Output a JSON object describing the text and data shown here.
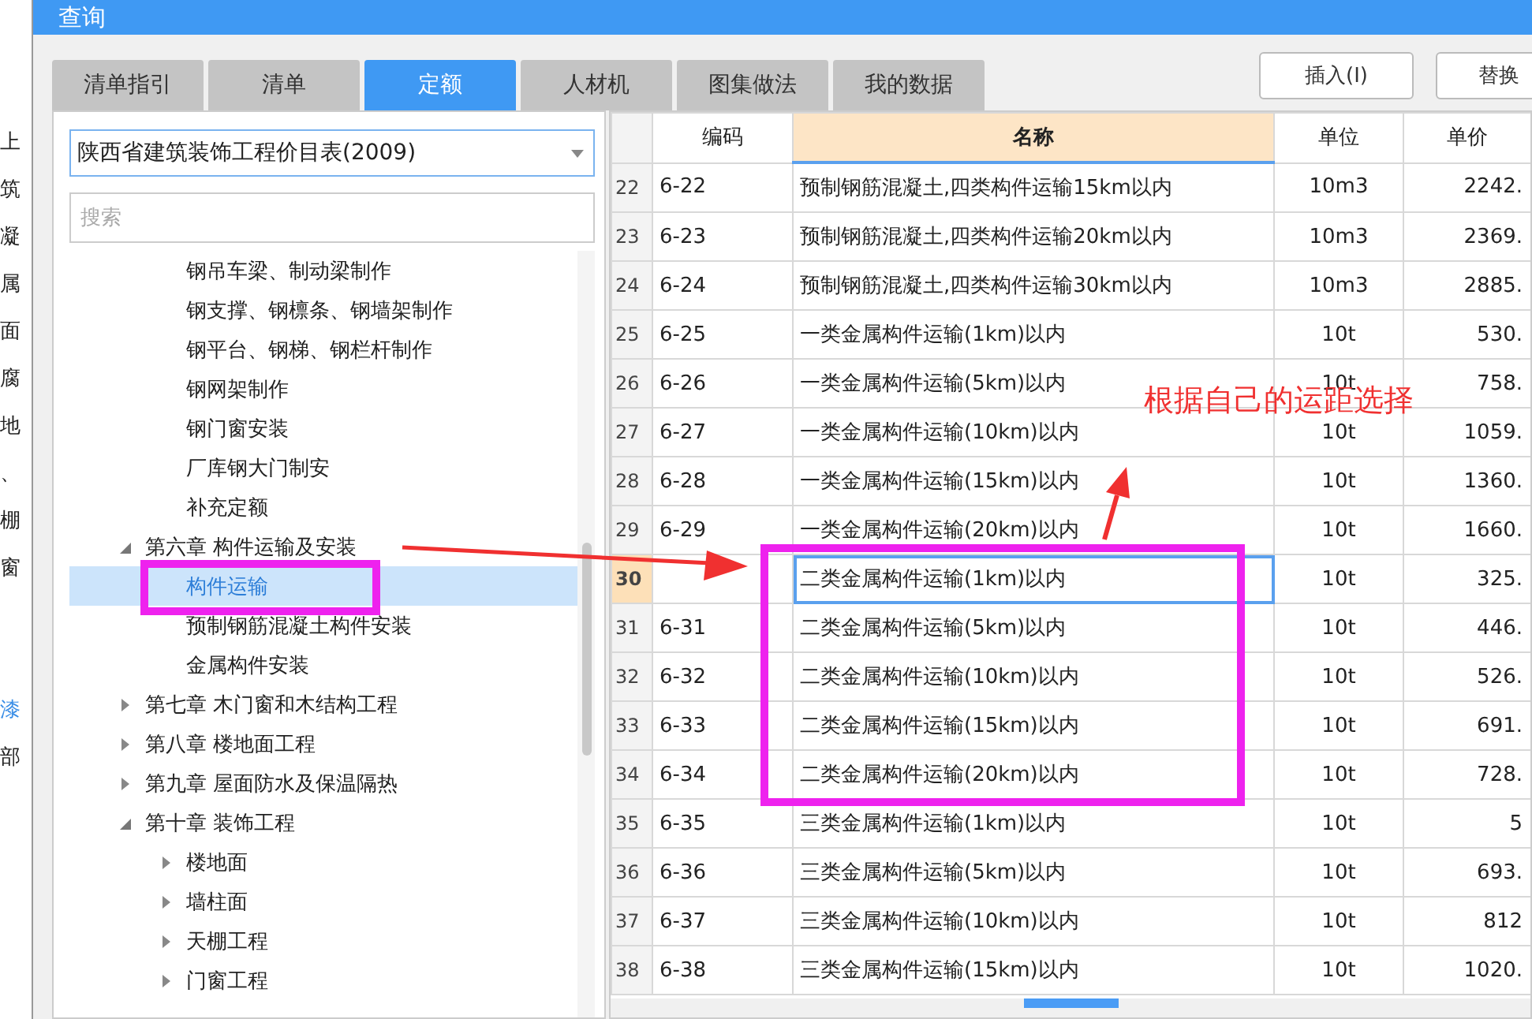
{
  "side_strip": {
    "items": [
      {
        "label": "上",
        "highlighted": false
      },
      {
        "label": "筑",
        "highlighted": false
      },
      {
        "label": "凝",
        "highlighted": false
      },
      {
        "label": "属",
        "highlighted": false
      },
      {
        "label": "面",
        "highlighted": false
      },
      {
        "label": "腐",
        "highlighted": false
      },
      {
        "label": "地",
        "highlighted": false
      },
      {
        "label": "、",
        "highlighted": false
      },
      {
        "label": "棚",
        "highlighted": false
      },
      {
        "label": "窗",
        "highlighted": false
      }
    ],
    "lower_items": [
      {
        "label": "漆",
        "highlighted": true
      },
      {
        "label": "部",
        "highlighted": false
      }
    ]
  },
  "window": {
    "title": "查询"
  },
  "tabs": [
    {
      "label": "清单指引",
      "selected": false
    },
    {
      "label": "清单",
      "selected": false
    },
    {
      "label": "定额",
      "selected": true
    },
    {
      "label": "人材机",
      "selected": false
    },
    {
      "label": "图集做法",
      "selected": false
    },
    {
      "label": "我的数据",
      "selected": false
    }
  ],
  "buttons": [
    "插入(I)",
    "替换"
  ],
  "library": {
    "value": "陕西省建筑装饰工程价目表(2009)"
  },
  "search": {
    "placeholder": "搜索"
  },
  "tree": [
    {
      "children": [
        {
          "label": "钢吊车梁、制动梁制作",
          "selected": false
        },
        {
          "label": "钢支撑、钢檩条、钢墙架制作",
          "selected": false
        },
        {
          "label": "钢平台、钢梯、钢栏杆制作",
          "selected": false
        },
        {
          "label": "钢网架制作",
          "selected": false
        },
        {
          "label": "钢门窗安装",
          "selected": false
        },
        {
          "label": "厂库钢大门制安",
          "selected": false
        },
        {
          "label": "补充定额",
          "selected": false
        }
      ]
    },
    {
      "label": "第六章 构件运输及安装",
      "expanded": true,
      "selected": false,
      "children": [
        {
          "label": "构件运输",
          "selected": true
        },
        {
          "label": "预制钢筋混凝土构件安装",
          "selected": false
        },
        {
          "label": "金属构件安装",
          "selected": false
        }
      ]
    },
    {
      "label": "第七章 木门窗和木结构工程",
      "expanded": false,
      "selected": false
    },
    {
      "label": "第八章 楼地面工程",
      "expanded": false,
      "selected": false
    },
    {
      "label": "第九章 屋面防水及保温隔热",
      "expanded": false,
      "selected": false
    },
    {
      "label": "第十章 装饰工程",
      "expanded": true,
      "selected": false,
      "children": [
        {
          "label": "楼地面",
          "expanded": false,
          "selected": false
        },
        {
          "label": "墙柱面",
          "expanded": false,
          "selected": false
        },
        {
          "label": "天棚工程",
          "expanded": false,
          "selected": false
        },
        {
          "label": "门窗工程",
          "expanded": false,
          "selected": false
        }
      ]
    }
  ],
  "table": {
    "columns": [
      "编码",
      "名称",
      "单位",
      "单价"
    ],
    "rows": [
      {
        "number": "22",
        "code": "6-22",
        "name": "预制钢筋混凝土,四类构件运输15km以内",
        "unit": "10m3",
        "price": "2242.",
        "selected": false
      },
      {
        "number": "23",
        "code": "6-23",
        "name": "预制钢筋混凝土,四类构件运输20km以内",
        "unit": "10m3",
        "price": "2369.",
        "selected": false
      },
      {
        "number": "24",
        "code": "6-24",
        "name": "预制钢筋混凝土,四类构件运输30km以内",
        "unit": "10m3",
        "price": "2885.",
        "selected": false
      },
      {
        "number": "25",
        "code": "6-25",
        "name": "一类金属构件运输(1km)以内",
        "unit": "10t",
        "price": "530.",
        "selected": false
      },
      {
        "number": "26",
        "code": "6-26",
        "name": "一类金属构件运输(5km)以内",
        "unit": "10t",
        "price": "758.",
        "selected": false
      },
      {
        "number": "27",
        "code": "6-27",
        "name": "一类金属构件运输(10km)以内",
        "unit": "10t",
        "price": "1059.",
        "selected": false
      },
      {
        "number": "28",
        "code": "6-28",
        "name": "一类金属构件运输(15km)以内",
        "unit": "10t",
        "price": "1360.",
        "selected": false
      },
      {
        "number": "29",
        "code": "6-29",
        "name": "一类金属构件运输(20km)以内",
        "unit": "10t",
        "price": "1660.",
        "selected": false
      },
      {
        "number": "30",
        "name": "二类金属构件运输(1km)以内",
        "unit": "10t",
        "price": "325.",
        "selected": true
      },
      {
        "number": "31",
        "code": "6-31",
        "name": "二类金属构件运输(5km)以内",
        "unit": "10t",
        "price": "446.",
        "selected": false
      },
      {
        "number": "32",
        "code": "6-32",
        "name": "二类金属构件运输(10km)以内",
        "unit": "10t",
        "price": "526.",
        "selected": false
      },
      {
        "number": "33",
        "code": "6-33",
        "name": "二类金属构件运输(15km)以内",
        "unit": "10t",
        "price": "691.",
        "selected": false
      },
      {
        "number": "34",
        "code": "6-34",
        "name": "二类金属构件运输(20km)以内",
        "unit": "10t",
        "price": "728.",
        "selected": false
      },
      {
        "number": "35",
        "code": "6-35",
        "name": "三类金属构件运输(1km)以内",
        "unit": "10t",
        "price": "5",
        "selected": false
      },
      {
        "number": "36",
        "code": "6-36",
        "name": "三类金属构件运输(5km)以内",
        "unit": "10t",
        "price": "693.",
        "selected": false
      },
      {
        "number": "37",
        "code": "6-37",
        "name": "三类金属构件运输(10km)以内",
        "unit": "10t",
        "price": "812",
        "selected": false
      },
      {
        "number": "38",
        "code": "6-38",
        "name": "三类金属构件运输(15km)以内",
        "unit": "10t",
        "price": "1020.",
        "selected": false
      }
    ]
  },
  "annotation": {
    "note": "根据自己的运距选择"
  }
}
